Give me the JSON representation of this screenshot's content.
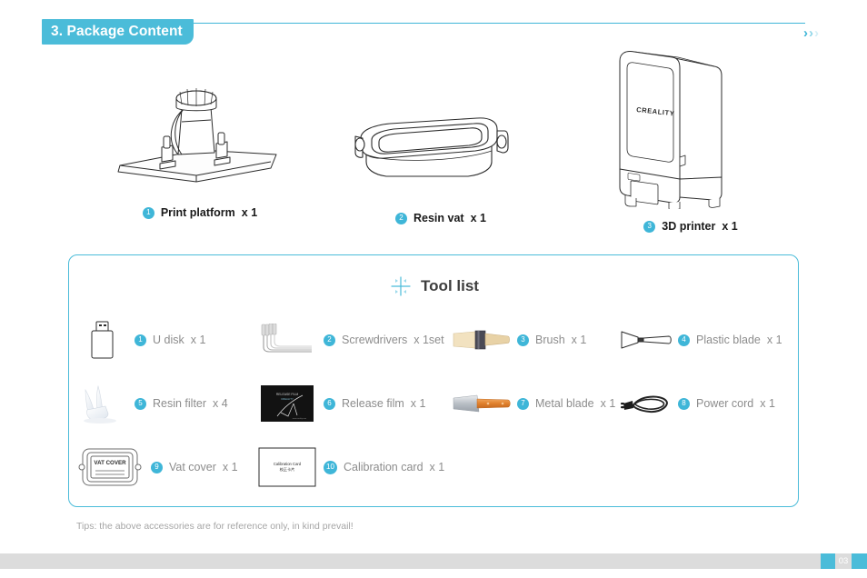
{
  "header": {
    "section_title": "3. Package Content",
    "accent_color": "#4bbcd9",
    "chevron1": "›",
    "chevron2": "›",
    "chevron3": "›"
  },
  "products": [
    {
      "number": "1",
      "name": "Print platform",
      "qty": "x 1",
      "icon": "print-platform-illustration"
    },
    {
      "number": "2",
      "name": "Resin vat",
      "qty": "x 1",
      "icon": "resin-vat-illustration"
    },
    {
      "number": "3",
      "name": "3D printer",
      "qty": "x 1",
      "icon": "3d-printer-illustration",
      "brand": "CREALITY"
    }
  ],
  "tool_list": {
    "title": "Tool list",
    "icon": "crosshair-icon",
    "items": [
      {
        "number": "1",
        "name": "U disk",
        "qty": "x 1",
        "icon": "usb-flash-drive-icon"
      },
      {
        "number": "2",
        "name": "Screwdrivers",
        "qty": "x 1set",
        "icon": "hex-key-set-icon"
      },
      {
        "number": "3",
        "name": "Brush",
        "qty": "x 1",
        "icon": "brush-icon"
      },
      {
        "number": "4",
        "name": "Plastic blade",
        "qty": "x 1",
        "icon": "plastic-blade-icon"
      },
      {
        "number": "5",
        "name": "Resin filter",
        "qty": "x 4",
        "icon": "resin-filter-icon"
      },
      {
        "number": "6",
        "name": "Release film",
        "qty": "x 1",
        "icon": "release-film-icon"
      },
      {
        "number": "7",
        "name": "Metal blade",
        "qty": "x 1",
        "icon": "metal-blade-icon"
      },
      {
        "number": "8",
        "name": "Power cord",
        "qty": "x 1",
        "icon": "power-cord-icon"
      },
      {
        "number": "9",
        "name": "Vat cover",
        "qty": "x 1",
        "icon": "vat-cover-icon"
      },
      {
        "number": "10",
        "name": "Calibration card",
        "qty": "x 1",
        "icon": "calibration-card-icon"
      }
    ],
    "vat_cover_label": "VAT  COVER",
    "calibration_card_label_en": "Calibration Card",
    "calibration_card_label_cn": "校正卡片"
  },
  "tips": "Tips: the above accessories are for reference only, in kind prevail!",
  "footer": {
    "page_number": "03",
    "band_color": "#dcdcdc",
    "accent_color": "#4bbcd9"
  }
}
